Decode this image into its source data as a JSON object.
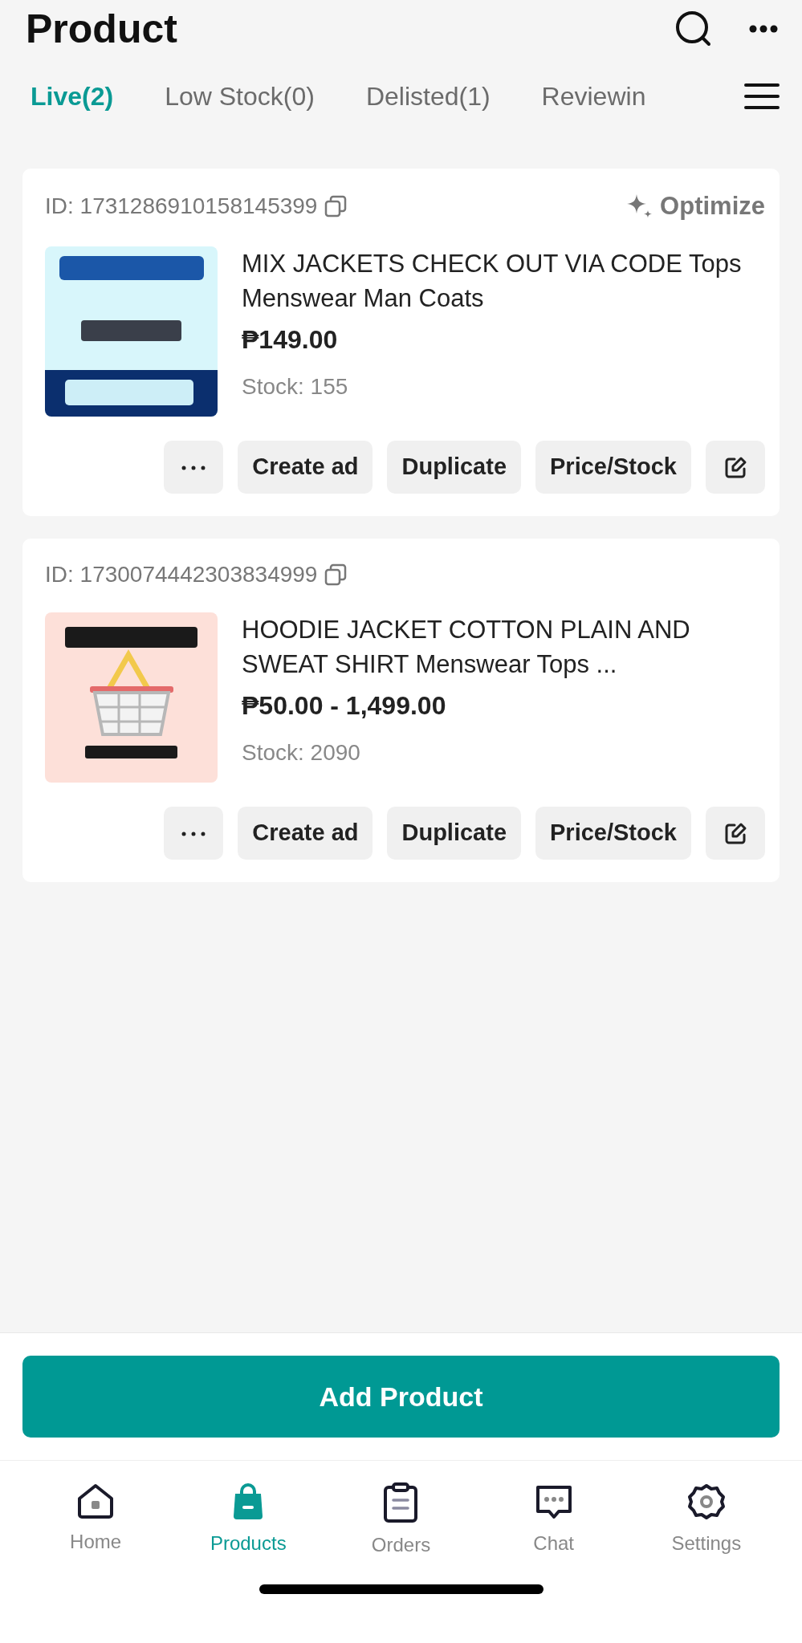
{
  "header": {
    "title": "Product"
  },
  "tabs": [
    {
      "label": "Live(2)",
      "selected": true
    },
    {
      "label": "Low Stock(0)",
      "selected": false
    },
    {
      "label": "Delisted(1)",
      "selected": false
    },
    {
      "label": "Reviewin",
      "selected": false
    }
  ],
  "products": [
    {
      "id": "ID: 1731286910158145399",
      "optimize": "Optimize",
      "title": "MIX JACKETS CHECK OUT VIA CODE Tops Menswear Man Coats",
      "price": "₱149.00",
      "stock": "Stock: 155",
      "actions": [
        "Create ad",
        "Duplicate",
        "Price/Stock"
      ]
    },
    {
      "id": "ID: 1730074442303834999",
      "title": "HOODIE JACKET COTTON PLAIN AND SWEAT SHIRT Menswear Tops ...",
      "price": "₱50.00 - 1,499.00",
      "stock": "Stock: 2090",
      "actions": [
        "Create ad",
        "Duplicate",
        "Price/Stock"
      ]
    }
  ],
  "add_button": "Add Product",
  "nav": [
    {
      "label": "Home",
      "selected": false
    },
    {
      "label": "Products",
      "selected": true
    },
    {
      "label": "Orders",
      "selected": false
    },
    {
      "label": "Chat",
      "selected": false
    },
    {
      "label": "Settings",
      "selected": false
    }
  ]
}
